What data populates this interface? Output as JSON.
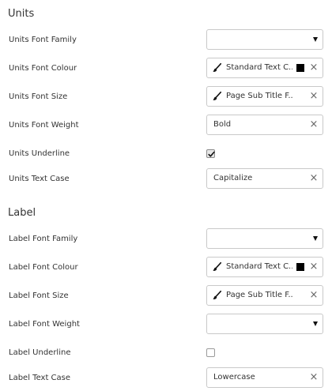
{
  "units": {
    "title": "Units",
    "font_family": {
      "label": "Units Font Family",
      "value": ""
    },
    "font_colour": {
      "label": "Units Font Colour",
      "value": "Standard Text C..",
      "swatch": "#000000"
    },
    "font_size": {
      "label": "Units Font Size",
      "value": "Page Sub Title F.."
    },
    "font_weight": {
      "label": "Units Font Weight",
      "value": "Bold"
    },
    "underline": {
      "label": "Units Underline",
      "checked": true
    },
    "text_case": {
      "label": "Units Text Case",
      "value": "Capitalize"
    }
  },
  "label": {
    "title": "Label",
    "font_family": {
      "label": "Label Font Family",
      "value": ""
    },
    "font_colour": {
      "label": "Label Font Colour",
      "value": "Standard Text C..",
      "swatch": "#000000"
    },
    "font_size": {
      "label": "Label Font Size",
      "value": "Page Sub Title F.."
    },
    "font_weight": {
      "label": "Label Font Weight",
      "value": ""
    },
    "underline": {
      "label": "Label Underline",
      "checked": false
    },
    "text_case": {
      "label": "Label Text Case",
      "value": "Lowercase"
    }
  },
  "icons": {
    "clear": "×",
    "brush": "paintbrush-icon",
    "dropdown": "caret-down-icon",
    "check": "checkmark-icon"
  }
}
